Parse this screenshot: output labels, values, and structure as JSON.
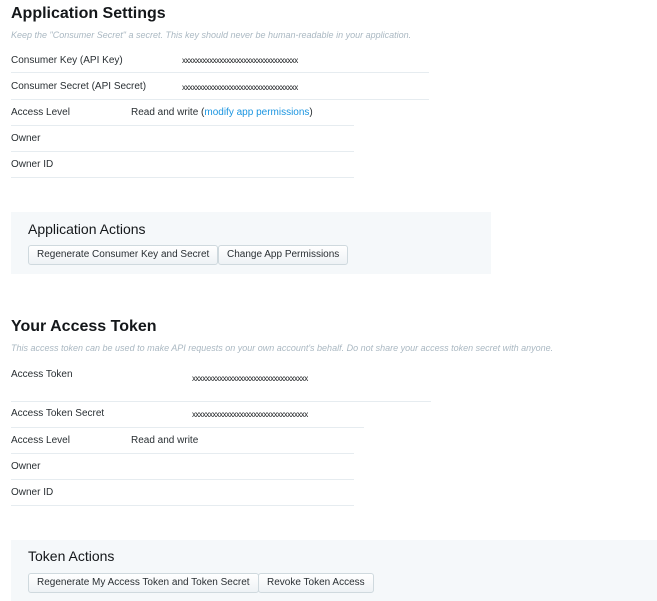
{
  "application_settings": {
    "title": "Application Settings",
    "note": "Keep the \"Consumer Secret\" a secret. This key should never be human-readable in your application.",
    "rows": {
      "consumer_key": {
        "label": "Consumer Key (API Key)",
        "value": "xxxxxxxxxxxxxxxxxxxxxxxxxxxxxxxxxx"
      },
      "consumer_secret": {
        "label": "Consumer Secret (API Secret)",
        "value": "xxxxxxxxxxxxxxxxxxxxxxxxxxxxxxxxxx"
      },
      "access_level": {
        "label": "Access Level",
        "value_prefix": "Read and write (",
        "link": "modify app permissions",
        "value_suffix": ")"
      },
      "owner": {
        "label": "Owner",
        "value": ""
      },
      "owner_id": {
        "label": "Owner ID",
        "value": ""
      }
    }
  },
  "application_actions": {
    "title": "Application Actions",
    "buttons": {
      "regenerate": "Regenerate Consumer Key and Secret",
      "change_permissions": "Change App Permissions"
    }
  },
  "access_token": {
    "title": "Your Access Token",
    "note": "This access token can be used to make API requests on your own account's behalf. Do not share your access token secret with anyone.",
    "rows": {
      "token": {
        "label": "Access Token",
        "value": "xxxxxxxxxxxxxxxxxxxxxxxxxxxxxxxxxx"
      },
      "token_secret": {
        "label": "Access Token Secret",
        "value": "xxxxxxxxxxxxxxxxxxxxxxxxxxxxxxxxxx"
      },
      "access_level": {
        "label": "Access Level",
        "value": "Read and write"
      },
      "owner": {
        "label": "Owner",
        "value": ""
      },
      "owner_id": {
        "label": "Owner ID",
        "value": ""
      }
    }
  },
  "token_actions": {
    "title": "Token Actions",
    "buttons": {
      "regenerate": "Regenerate My Access Token and Token Secret",
      "revoke": "Revoke Token Access"
    }
  },
  "colors": {
    "link": "#1b95e0",
    "panel_background": "#f5f8fa",
    "note_text": "#aab8c2",
    "rule": "#e6ecf0"
  }
}
